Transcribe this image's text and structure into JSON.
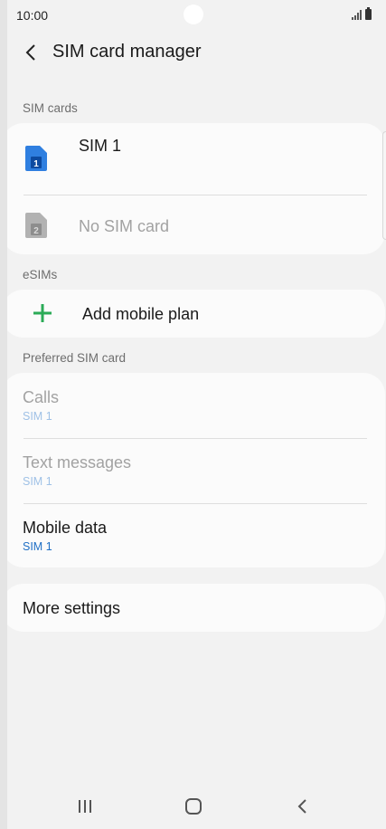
{
  "status_bar": {
    "time": "10:00"
  },
  "header": {
    "title": "SIM card manager"
  },
  "sections": {
    "sim_cards": "SIM cards",
    "esims": "eSIMs",
    "preferred": "Preferred SIM card"
  },
  "sim_cards": [
    {
      "label": "SIM 1",
      "slot": "1",
      "enabled": true,
      "icon_color": "#2f7fe0"
    },
    {
      "label": "No SIM card",
      "slot": "2",
      "enabled": false,
      "icon_color": "#b2b2b2"
    }
  ],
  "esims": {
    "add_label": "Add mobile plan",
    "plus_color": "#2bab57"
  },
  "preferred": [
    {
      "title": "Calls",
      "value": "SIM 1",
      "enabled": false
    },
    {
      "title": "Text messages",
      "value": "SIM 1",
      "enabled": false
    },
    {
      "title": "Mobile data",
      "value": "SIM 1",
      "enabled": true
    }
  ],
  "more_settings": "More settings",
  "nav": {
    "recents": "recents-icon",
    "home": "home-icon",
    "back": "back-icon"
  }
}
